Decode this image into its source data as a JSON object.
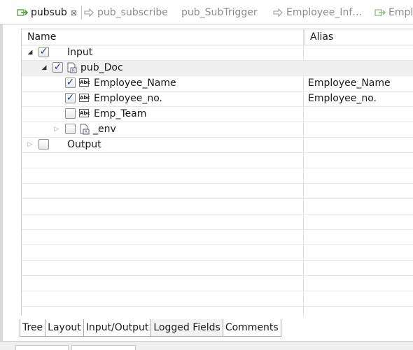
{
  "editor_tabs": [
    {
      "label": "pubsub",
      "icon": "publish-subscribe-icon",
      "active": true,
      "close": "⊠"
    },
    {
      "label": "pub_subscribe",
      "icon": "arrow-right-icon",
      "active": false
    },
    {
      "label": "pub_SubTrigger",
      "icon": "",
      "active": false
    },
    {
      "label": "Employee_Inf…",
      "icon": "arrow-right-icon",
      "active": false
    },
    {
      "label": "Emplo",
      "icon": "publish-subscribe-icon",
      "active": false
    }
  ],
  "table": {
    "columns": {
      "name": "Name",
      "alias": "Alias"
    },
    "rows": [
      {
        "name": "Input",
        "alias": "",
        "checked": true,
        "expanded": true
      },
      {
        "name": "pub_Doc",
        "alias": "",
        "checked": true,
        "expanded": true
      },
      {
        "name": "Employee_Name",
        "alias": "Employee_Name",
        "checked": true,
        "type_icon": "Abc"
      },
      {
        "name": "Employee_no.",
        "alias": "Employee_no.",
        "checked": true,
        "type_icon": "Abc"
      },
      {
        "name": "Emp_Team",
        "alias": "",
        "checked": false,
        "type_icon": "Abc"
      },
      {
        "name": "_env",
        "alias": "",
        "checked": false,
        "expanded": false
      },
      {
        "name": "Output",
        "alias": "",
        "checked": false,
        "expanded": false
      }
    ]
  },
  "bottom_tabs": [
    "Tree",
    "Layout",
    "Input/Output",
    "Logged Fields",
    "Comments"
  ],
  "checkmark": "✓",
  "colors": {
    "check": "#1c3f9c",
    "selected_row": "#f0f0f0",
    "tab_inactive_text": "#8c8c8c"
  }
}
